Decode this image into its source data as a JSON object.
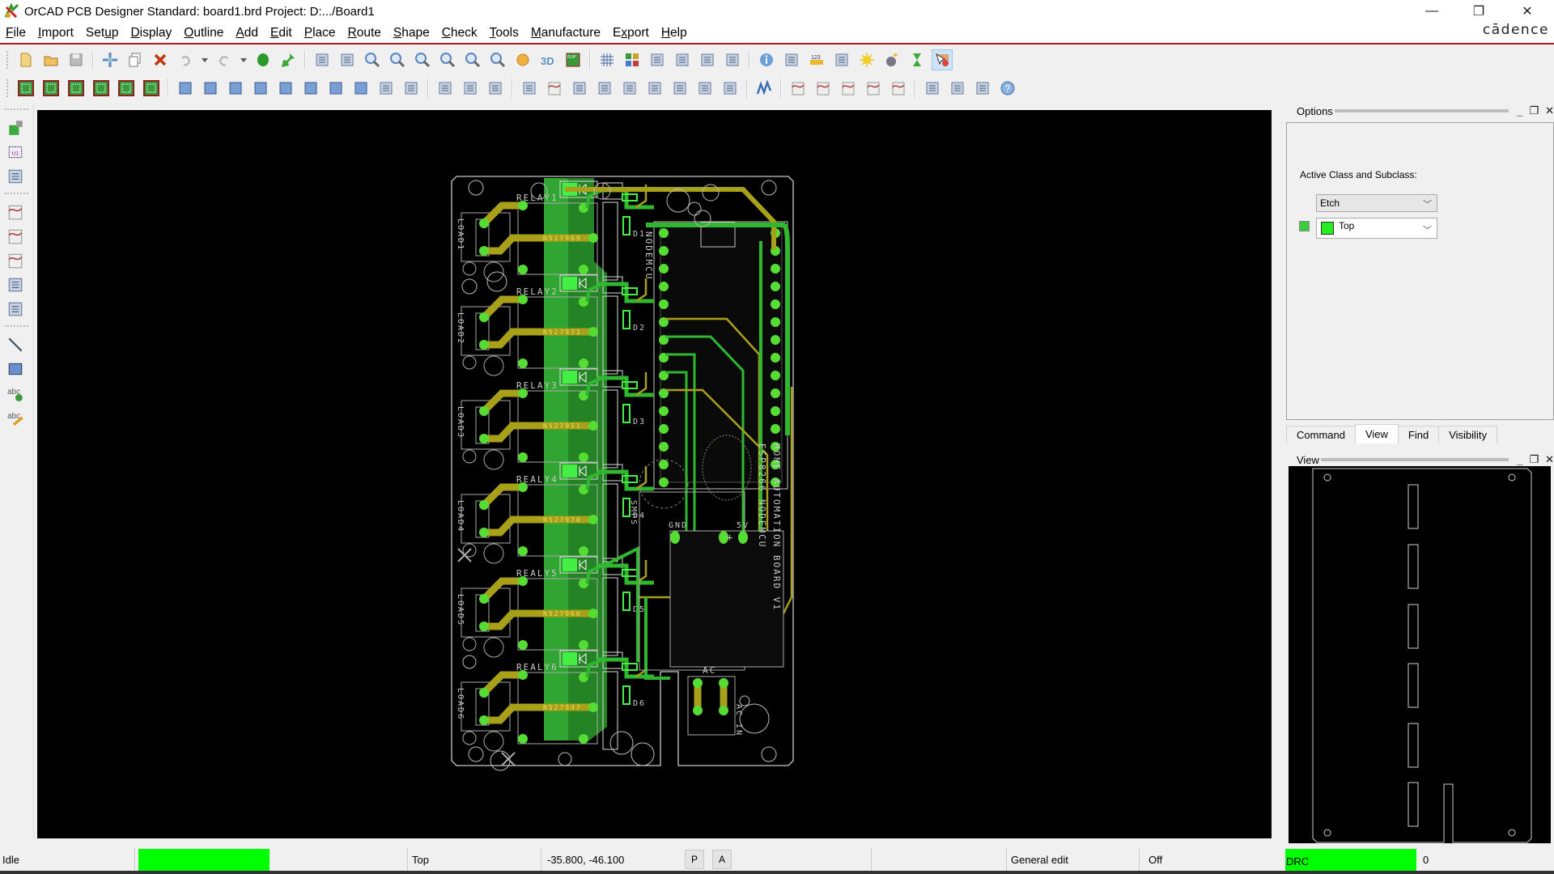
{
  "window": {
    "title": "OrCAD PCB Designer Standard: board1.brd  Project: D:.../Board1",
    "brand": "cādence",
    "controls": [
      "minimize",
      "restore",
      "close"
    ]
  },
  "menu": [
    {
      "label": "File",
      "mnemonic": "F"
    },
    {
      "label": "Import",
      "mnemonic": "I"
    },
    {
      "label": "Setup",
      "mnemonic": "u"
    },
    {
      "label": "Display",
      "mnemonic": "D"
    },
    {
      "label": "Outline",
      "mnemonic": "O"
    },
    {
      "label": "Add",
      "mnemonic": "A"
    },
    {
      "label": "Edit",
      "mnemonic": "E"
    },
    {
      "label": "Place",
      "mnemonic": "P"
    },
    {
      "label": "Route",
      "mnemonic": "R"
    },
    {
      "label": "Shape",
      "mnemonic": "S"
    },
    {
      "label": "Check",
      "mnemonic": "C"
    },
    {
      "label": "Tools",
      "mnemonic": "T"
    },
    {
      "label": "Manufacture",
      "mnemonic": "M"
    },
    {
      "label": "Export",
      "mnemonic": "x"
    },
    {
      "label": "Help",
      "mnemonic": "H"
    }
  ],
  "toolbar_row1": [
    [
      "new-icon",
      "open-icon",
      "save-icon"
    ],
    [
      "move-icon",
      "copy-icon",
      "delete-icon",
      "undo-icon",
      "undo-dropdown-icon",
      "redo-icon",
      "redo-dropdown-icon",
      "unrats-icon",
      "pin-icon"
    ],
    [
      "unrats-all-icon",
      "rats-all-icon",
      "zoom-points-icon",
      "zoom-fit-icon",
      "zoom-in-icon",
      "zoom-out-icon",
      "zoom-prev-icon",
      "zoom-world-icon",
      "refresh-icon",
      "3d-view-icon",
      "flip-icon"
    ],
    [
      "grid-icon",
      "color-icon",
      "layer-icon",
      "stackup-icon",
      "constraint-manager-icon",
      "cross-section-icon"
    ],
    [
      "info-icon",
      "property-icon",
      "measure-icon",
      "highlight-icon",
      "shadow-icon",
      "dehighlight-icon",
      "timer-icon",
      "select-mode-icon"
    ]
  ],
  "toolbar_row2": [
    [
      "outline-icon-1",
      "outline-icon-2",
      "outline-icon-3",
      "outline-icon-4",
      "outline-icon-5",
      "outline-icon-6"
    ],
    [
      "shape-l-icon",
      "shape-rect-icon",
      "shape-circle-icon",
      "select-shape-icon",
      "merge-shape-icon",
      "void-shape-icon",
      "void-rect-icon",
      "void-circle-icon",
      "edit-boundary-icon",
      "delete-islands-icon"
    ],
    [
      "testpoint-icon",
      "dimension-icon",
      "dimension-linear-icon"
    ],
    [
      "odb-icon",
      "slide-icon",
      "spin-icon",
      "snapshot-icon",
      "rename-refdes-icon",
      "report-icon",
      "testprep-icon",
      "placement-grid-icon",
      "array-icon"
    ],
    [
      "route-icon"
    ],
    [
      "add-connect-icon",
      "slide-trace-icon",
      "custom-smooth-icon",
      "vertex-icon",
      "delay-tune-icon"
    ],
    [
      "window-icon",
      "cm-icon",
      "xnet-icon",
      "help-icon"
    ]
  ],
  "left_toolbar": [
    "place-manual-icon",
    "component-u1-icon",
    "swap-icon",
    "add-connect-icon",
    "slide-icon",
    "delay-tune-icon",
    "fanout-icon",
    "bus-route-icon",
    "add-line-icon",
    "add-rect-icon",
    "add-text-icon",
    "edit-text-icon"
  ],
  "options_panel": {
    "title": "Options",
    "label": "Active Class and Subclass:",
    "class_value": "Etch",
    "subclass_value": "Top",
    "subclass_color": "#22ee22"
  },
  "tabs": [
    {
      "label": "Command",
      "active": false
    },
    {
      "label": "View",
      "active": true
    },
    {
      "label": "Find",
      "active": false
    },
    {
      "label": "Visibility",
      "active": false
    }
  ],
  "view_panel": {
    "title": "View"
  },
  "pcb": {
    "relays": [
      "RELAY1",
      "RELAY2",
      "RELAY3",
      "REALY4",
      "REALY5",
      "REALY6"
    ],
    "loads": [
      "LOAD1",
      "LOAD2",
      "LOAD3",
      "LOAD4",
      "LOAD5",
      "LOAD6"
    ],
    "diodes": [
      "D1",
      "D2",
      "D3",
      "D4",
      "D5",
      "D6"
    ],
    "part_labels": [
      "N527969",
      "N527971",
      "N527951",
      "N527970",
      "N527966",
      "N527947"
    ],
    "module_label": "NODEMCU",
    "board_title": "HOME AUTOMATION BOARD V1",
    "board_subtitle": "ESP8266 NODEMCU",
    "smps_label": "SMPS",
    "gnd_label": "GND",
    "v5_label": "5V",
    "ac_label": "AC",
    "ac_in_label": "AC IN",
    "colors": {
      "top_etch": "#2fb82f",
      "bright": "#44ee44",
      "bottom_etch": "#a8a018",
      "silk": "#c8c8c8",
      "pad": "#55dd33"
    }
  },
  "status": {
    "state": "Idle",
    "state_color": "#00ff00",
    "layer": "Top",
    "coords": "-35.800, -46.100",
    "p_button": "P",
    "a_button": "A",
    "mode": "General edit",
    "snap": "Off",
    "drc_label": "DRC",
    "drc_color": "#00ff00",
    "drc_count": "0"
  }
}
